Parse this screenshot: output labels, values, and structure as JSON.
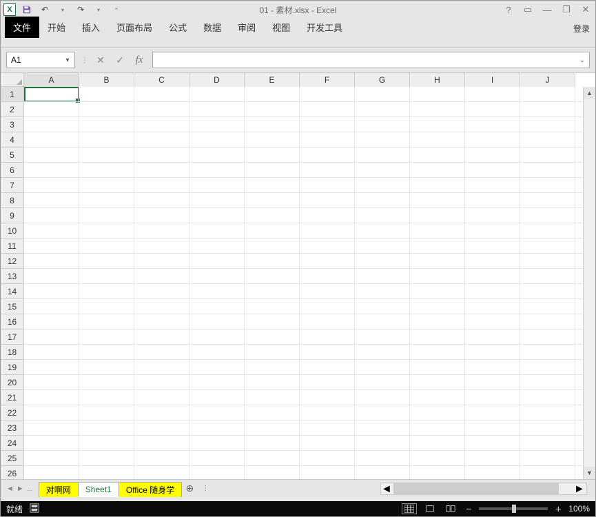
{
  "app": {
    "title": "01 - 素材.xlsx - Excel",
    "icon_letter": "X"
  },
  "qat": {
    "undo_tip": "↶",
    "redo_tip": "↷"
  },
  "window": {
    "help": "?",
    "ribbon_opts": "▭",
    "minimize": "—",
    "restore": "❐",
    "close": "✕"
  },
  "ribbon": {
    "tabs": [
      "文件",
      "开始",
      "插入",
      "页面布局",
      "公式",
      "数据",
      "审阅",
      "视图",
      "开发工具"
    ],
    "login": "登录"
  },
  "formula": {
    "namebox_value": "A1",
    "cancel": "✕",
    "enter": "✓",
    "fx": "fx",
    "value": ""
  },
  "grid": {
    "columns": [
      "A",
      "B",
      "C",
      "D",
      "E",
      "F",
      "G",
      "H",
      "I",
      "J"
    ],
    "row_count": 26,
    "active_cell": "A1"
  },
  "sheets": {
    "nav_first": "◄",
    "nav_prev": "►",
    "tabs": [
      {
        "name": "对啊网",
        "color": "yellow",
        "active": false
      },
      {
        "name": "Sheet1",
        "color": "white",
        "active": true
      },
      {
        "name": "Office 随身学",
        "color": "yellow",
        "active": false
      }
    ],
    "add": "⊕"
  },
  "status": {
    "ready": "就绪",
    "zoom_out": "−",
    "zoom_in": "+",
    "zoom_value": "100%"
  }
}
